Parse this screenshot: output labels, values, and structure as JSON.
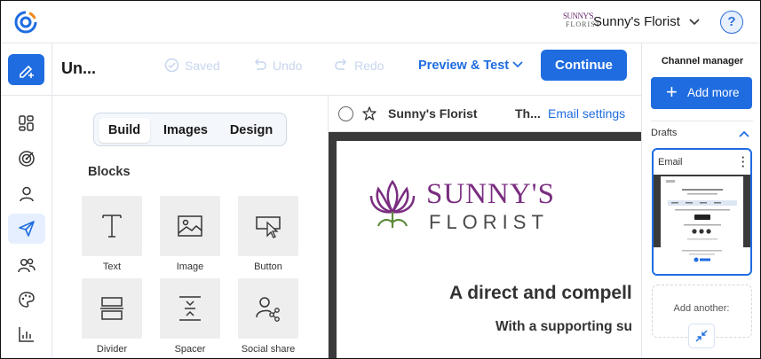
{
  "header": {
    "brand_logo_text_line1": "SUNNY'S",
    "brand_logo_text_line2": "FLORIST",
    "account_name": "Sunny's Florist",
    "help_label": "?"
  },
  "toolbar": {
    "doc_title": "Un...",
    "saved_label": "Saved",
    "undo_label": "Undo",
    "redo_label": "Redo",
    "preview_label": "Preview & Test",
    "continue_label": "Continue"
  },
  "build_panel": {
    "tabs": [
      {
        "label": "Build",
        "active": true
      },
      {
        "label": "Images",
        "active": false
      },
      {
        "label": "Design",
        "active": false
      }
    ],
    "blocks_title": "Blocks",
    "blocks": [
      {
        "label": "Text",
        "icon": "text-icon"
      },
      {
        "label": "Image",
        "icon": "image-icon"
      },
      {
        "label": "Button",
        "icon": "button-icon"
      },
      {
        "label": "Divider",
        "icon": "divider-icon"
      },
      {
        "label": "Spacer",
        "icon": "spacer-icon"
      },
      {
        "label": "Social share",
        "icon": "social-share-icon"
      }
    ]
  },
  "email_preview": {
    "from_name": "Sunny's Florist",
    "subject_truncated": "Th...",
    "email_settings_label": "Email settings",
    "logo_line1": "SUNNY'S",
    "logo_line2": "FLORIST",
    "headline": "A direct and compell",
    "subheadline": "With a supporting su"
  },
  "channel_manager": {
    "title": "Channel manager",
    "add_more_label": "Add more",
    "drafts_label": "Drafts",
    "draft_card_title": "Email",
    "add_another_label": "Add another:"
  },
  "colors": {
    "primary": "#1f6ce0",
    "brand_purple": "#7a2d80",
    "canvas_dark": "#3a3a3a"
  }
}
